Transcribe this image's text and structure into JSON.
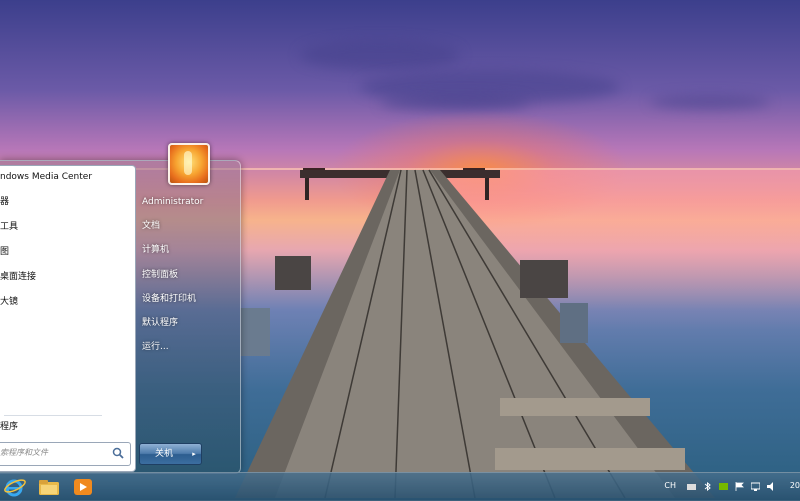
{
  "start_menu": {
    "programs": [
      {
        "label": "ndows Media Center"
      },
      {
        "label": "器"
      },
      {
        "label": "工具"
      },
      {
        "label": "图"
      },
      {
        "label": "桌面连接"
      },
      {
        "label": "大镜"
      }
    ],
    "all_programs_label": "程序",
    "search_placeholder": "索程序和文件",
    "right_items": [
      {
        "label": "Administrator"
      },
      {
        "label": "文档"
      },
      {
        "label": "计算机"
      },
      {
        "label": "控制面板"
      },
      {
        "label": "设备和打印机"
      },
      {
        "label": "默认程序"
      },
      {
        "label": "运行..."
      }
    ],
    "shutdown_label": "关机",
    "shutdown_arrow": "▸"
  },
  "taskbar": {
    "pinned": [
      {
        "icon": "internet-explorer-icon"
      },
      {
        "icon": "folder-icon"
      },
      {
        "icon": "media-player-icon"
      }
    ],
    "tray": {
      "lang": "CH",
      "clock": "20"
    }
  }
}
